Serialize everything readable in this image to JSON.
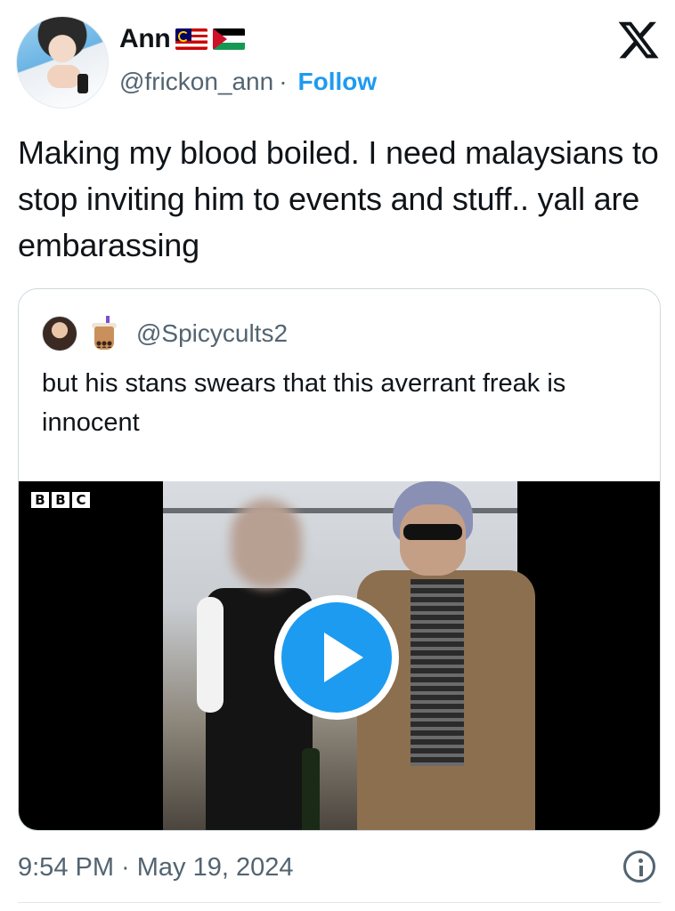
{
  "author": {
    "display_name": "Ann",
    "handle": "@frickon_ann",
    "separator": "·",
    "follow_label": "Follow",
    "flags": [
      "malaysia-flag-icon",
      "palestine-flag-icon"
    ]
  },
  "brand": {
    "icon": "x-logo-icon"
  },
  "tweet": {
    "text": "Making my blood boiled. I need malaysians to stop inviting him to events and stuff.. yall are embarassing"
  },
  "quoted_tweet": {
    "handle": "@Spicycults2",
    "avatar_icon": "profile-avatar",
    "emoji_icon": "bubble-tea-icon",
    "text": "but his stans swears that this averrant freak is innocent",
    "media": {
      "type": "video",
      "watermark": [
        "B",
        "B",
        "C"
      ],
      "play_icon": "play-icon"
    }
  },
  "footer": {
    "timestamp": "9:54 PM · May 19, 2024",
    "info_icon": "info-icon"
  },
  "colors": {
    "accent": "#1d9bf0",
    "text_primary": "#0f1419",
    "text_secondary": "#536471",
    "border": "#cfd9de"
  }
}
